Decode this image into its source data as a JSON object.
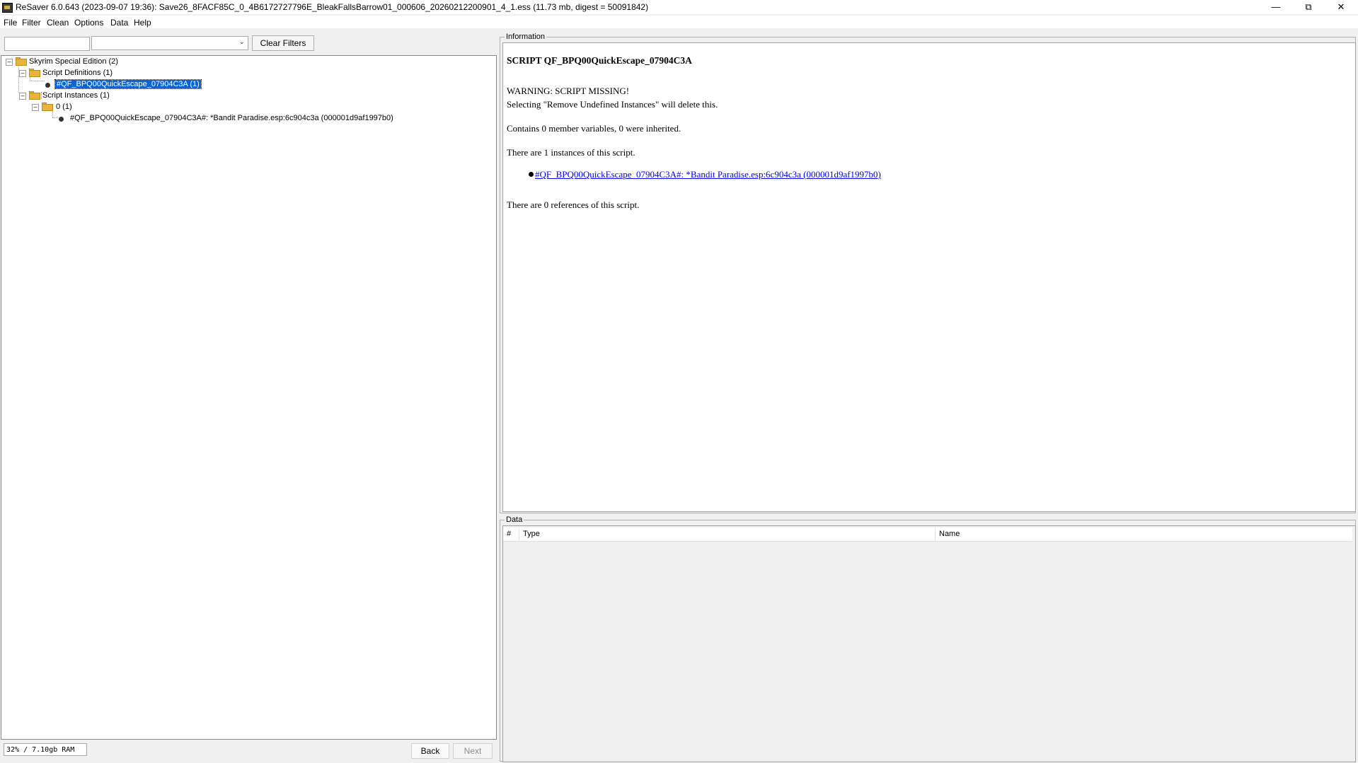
{
  "window": {
    "title": "ReSaver 6.0.643 (2023-09-07 19:36): Save26_8FACF85C_0_4B6172727796E_BleakFallsBarrow01_000606_20260212200901_4_1.ess (11.73 mb, digest = 50091842)",
    "minimize": "—",
    "maximize": "⧉",
    "close": "✕"
  },
  "menu": {
    "file": "File",
    "filter": "Filter",
    "clean": "Clean",
    "options": "Options",
    "data": "Data",
    "help": "Help"
  },
  "filter": {
    "text_value": "",
    "combo_value": "",
    "clear_label": "Clear Filters"
  },
  "tree": {
    "root": "Skyrim Special Edition (2)",
    "definitions": "Script Definitions (1)",
    "definition_item": "#QF_BPQ00QuickEscape_07904C3A (1)",
    "instances": "Script Instances (1)",
    "instance_group": "0 (1)",
    "instance_item": "#QF_BPQ00QuickEscape_07904C3A#: *Bandit Paradise.esp:6c904c3a (000001d9af1997b0)"
  },
  "status": {
    "memory": "32% / 7.10gb RAM",
    "back_label": "Back",
    "next_label": "Next"
  },
  "info": {
    "group_label": "Information",
    "title": "SCRIPT QF_BPQ00QuickEscape_07904C3A",
    "warning": "WARNING: SCRIPT MISSING!",
    "remove_hint": "Selecting \"Remove Undefined Instances\" will delete this.",
    "members": "Contains 0 member variables, 0 were inherited.",
    "instances_count": "There are 1 instances of this script.",
    "instance_link": "#QF_BPQ00QuickEscape_07904C3A#: *Bandit Paradise.esp:6c904c3a (000001d9af1997b0)",
    "references": "There are 0 references of this script."
  },
  "data_table": {
    "group_label": "Data",
    "columns": [
      "#",
      "Type",
      "Name"
    ],
    "rows": []
  }
}
